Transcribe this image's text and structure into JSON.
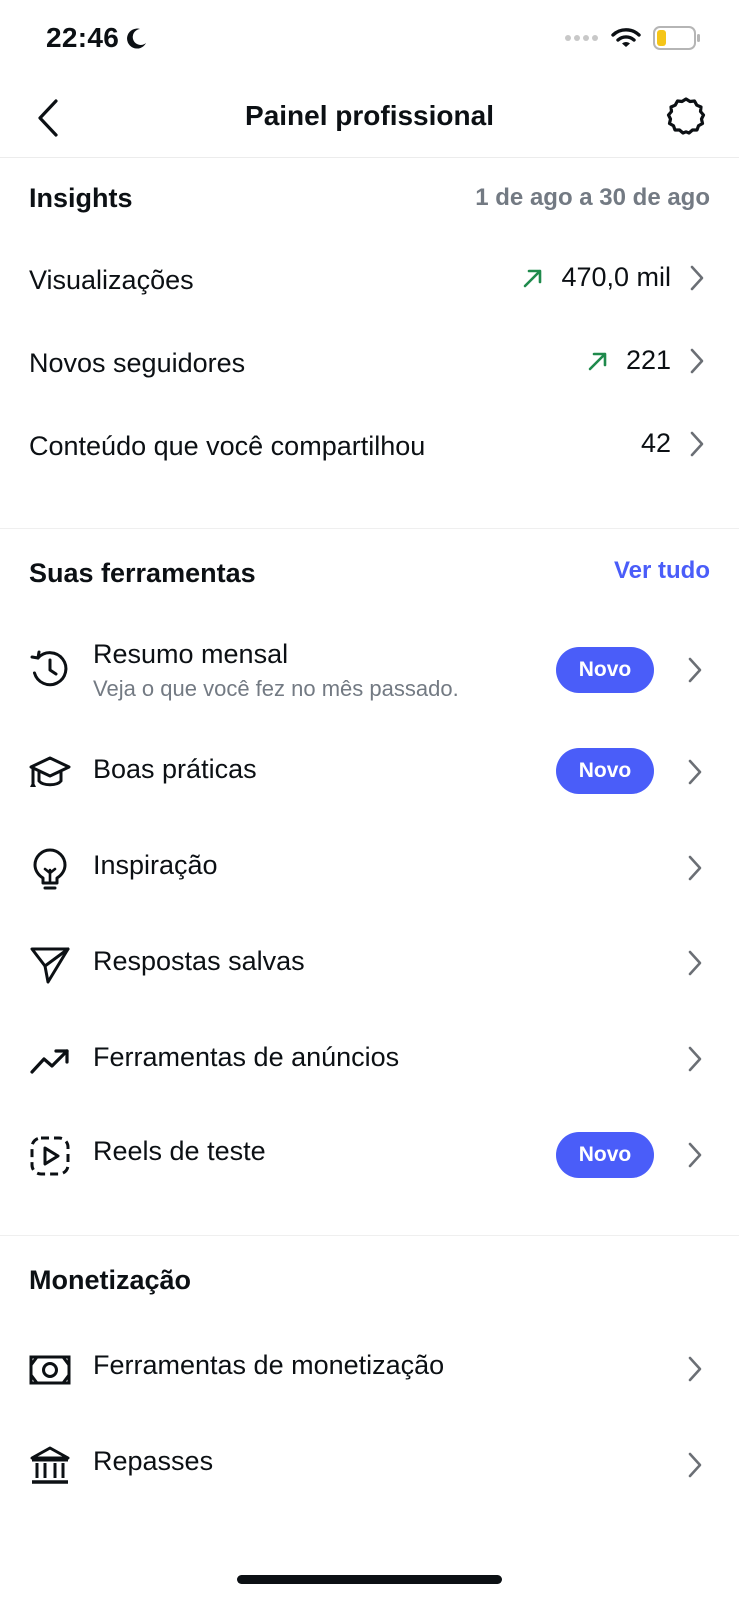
{
  "status_bar": {
    "time": "22:46",
    "icons": [
      "moon-icon",
      "signal-icon",
      "wifi-icon",
      "battery-icon"
    ],
    "battery_color": "#f5c518"
  },
  "nav": {
    "title": "Painel profissional",
    "icons": [
      "back-chevron-icon",
      "settings-gear-icon"
    ]
  },
  "insights": {
    "title": "Insights",
    "date_range": "1 de ago a 30 de ago",
    "trend_color": "#1f8a4c",
    "rows": [
      {
        "label": "Visualizações",
        "value": "470,0 mil",
        "trend": "up"
      },
      {
        "label": "Novos seguidores",
        "value": "221",
        "trend": "up"
      },
      {
        "label": "Conteúdo que você compartilhou",
        "value": "42",
        "trend": "none"
      }
    ]
  },
  "tools": {
    "title": "Suas ferramentas",
    "see_all": "Ver tudo",
    "accent_color": "#4a5df9",
    "new_badge": "Novo",
    "items": [
      {
        "label": "Resumo mensal",
        "subtitle": "Veja o que você fez no mês passado.",
        "icon": "history-clock-icon",
        "is_new": true
      },
      {
        "label": "Boas práticas",
        "icon": "graduation-cap-icon",
        "is_new": true
      },
      {
        "label": "Inspiração",
        "icon": "lightbulb-icon",
        "is_new": false
      },
      {
        "label": "Respostas salvas",
        "icon": "paper-plane-icon",
        "is_new": false
      },
      {
        "label": "Ferramentas de anúncios",
        "icon": "trending-up-icon",
        "is_new": false
      },
      {
        "label": "Reels de teste",
        "icon": "reels-test-icon",
        "is_new": true
      }
    ]
  },
  "monetization": {
    "title": "Monetização",
    "items": [
      {
        "label": "Ferramentas de monetização",
        "icon": "money-bill-icon"
      },
      {
        "label": "Repasses",
        "icon": "bank-icon"
      }
    ]
  }
}
